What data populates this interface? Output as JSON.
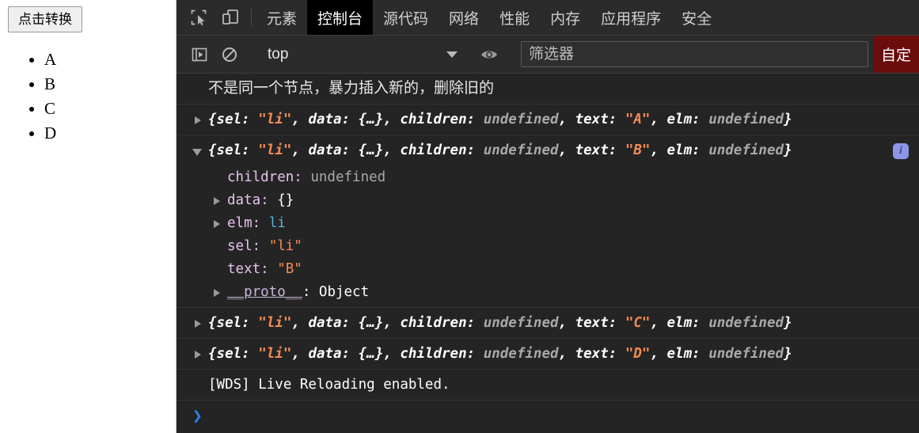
{
  "page": {
    "button_label": "点击转换",
    "list_items": [
      "A",
      "B",
      "C",
      "D"
    ]
  },
  "devtools": {
    "icons": {
      "inspect": "inspect-element-icon",
      "device": "device-toolbar-icon"
    },
    "tabs": [
      {
        "label": "元素",
        "active": false
      },
      {
        "label": "控制台",
        "active": true
      },
      {
        "label": "源代码",
        "active": false
      },
      {
        "label": "网络",
        "active": false
      },
      {
        "label": "性能",
        "active": false
      },
      {
        "label": "内存",
        "active": false
      },
      {
        "label": "应用程序",
        "active": false
      },
      {
        "label": "安全",
        "active": false
      }
    ],
    "filterbar": {
      "sidebar_toggle": "console-sidebar-icon",
      "clear_icon": "clear-console-icon",
      "context": "top",
      "eye_icon": "live-expression-eye-icon",
      "filter_placeholder": "筛选器",
      "filter_value": "",
      "level_label": "自定"
    },
    "console": {
      "messages": [
        {
          "kind": "log",
          "arrow": "none",
          "text": "不是同一个节点，暴力插入新的，删除旧的"
        },
        {
          "kind": "object",
          "arrow": "right",
          "parts": [
            {
              "t": "{sel: ",
              "c": "c-key"
            },
            {
              "t": "\"li\"",
              "c": "c-str"
            },
            {
              "t": ", data: {…}, children: ",
              "c": "c-key"
            },
            {
              "t": "undefined",
              "c": "c-undef"
            },
            {
              "t": ", text: ",
              "c": "c-key"
            },
            {
              "t": "\"A\"",
              "c": "c-str"
            },
            {
              "t": ", elm: ",
              "c": "c-key"
            },
            {
              "t": "undefined",
              "c": "c-undef"
            },
            {
              "t": "}",
              "c": "c-punct"
            }
          ]
        },
        {
          "kind": "object-expanded",
          "arrow": "down",
          "badge": "i",
          "parts": [
            {
              "t": "{sel: ",
              "c": "c-key"
            },
            {
              "t": "\"li\"",
              "c": "c-str"
            },
            {
              "t": ", data: {…}, children: ",
              "c": "c-key"
            },
            {
              "t": "undefined",
              "c": "c-undef"
            },
            {
              "t": ", text: ",
              "c": "c-key"
            },
            {
              "t": "\"B\"",
              "c": "c-str"
            },
            {
              "t": ", elm: ",
              "c": "c-key"
            },
            {
              "t": "undefined",
              "c": "c-undef"
            },
            {
              "t": "}",
              "c": "c-punct"
            }
          ],
          "props": [
            {
              "arrow": "none",
              "parts": [
                {
                  "t": "children: ",
                  "c": "c-prop"
                },
                {
                  "t": "undefined",
                  "c": "c-undef"
                }
              ]
            },
            {
              "arrow": "right",
              "parts": [
                {
                  "t": "data: ",
                  "c": "c-prop"
                },
                {
                  "t": "{}",
                  "c": "c-plain"
                }
              ]
            },
            {
              "arrow": "right",
              "parts": [
                {
                  "t": "elm: ",
                  "c": "c-prop"
                },
                {
                  "t": "li",
                  "c": "c-node"
                }
              ]
            },
            {
              "arrow": "none",
              "parts": [
                {
                  "t": "sel: ",
                  "c": "c-prop"
                },
                {
                  "t": "\"li\"",
                  "c": "c-str"
                }
              ]
            },
            {
              "arrow": "none",
              "parts": [
                {
                  "t": "text: ",
                  "c": "c-prop"
                },
                {
                  "t": "\"B\"",
                  "c": "c-str"
                }
              ]
            },
            {
              "arrow": "right",
              "proto": true,
              "parts": [
                {
                  "t": "__proto__",
                  "c": "proto-name"
                },
                {
                  "t": ": ",
                  "c": "c-plain"
                },
                {
                  "t": "Object",
                  "c": "c-plain"
                }
              ]
            }
          ]
        },
        {
          "kind": "object",
          "arrow": "right",
          "parts": [
            {
              "t": "{sel: ",
              "c": "c-key"
            },
            {
              "t": "\"li\"",
              "c": "c-str"
            },
            {
              "t": ", data: {…}, children: ",
              "c": "c-key"
            },
            {
              "t": "undefined",
              "c": "c-undef"
            },
            {
              "t": ", text: ",
              "c": "c-key"
            },
            {
              "t": "\"C\"",
              "c": "c-str"
            },
            {
              "t": ", elm: ",
              "c": "c-key"
            },
            {
              "t": "undefined",
              "c": "c-undef"
            },
            {
              "t": "}",
              "c": "c-punct"
            }
          ]
        },
        {
          "kind": "object",
          "arrow": "right",
          "parts": [
            {
              "t": "{sel: ",
              "c": "c-key"
            },
            {
              "t": "\"li\"",
              "c": "c-str"
            },
            {
              "t": ", data: {…}, children: ",
              "c": "c-key"
            },
            {
              "t": "undefined",
              "c": "c-undef"
            },
            {
              "t": ", text: ",
              "c": "c-key"
            },
            {
              "t": "\"D\"",
              "c": "c-str"
            },
            {
              "t": ", elm: ",
              "c": "c-key"
            },
            {
              "t": "undefined",
              "c": "c-undef"
            },
            {
              "t": "}",
              "c": "c-punct"
            }
          ]
        },
        {
          "kind": "mono-log",
          "arrow": "none",
          "text": "[WDS] Live Reloading enabled."
        }
      ],
      "prompt_caret": "❯"
    }
  },
  "colors": {
    "devtools_bg": "#242424",
    "toolbar_bg": "#2b2b2b",
    "active_tab_bg": "#000000",
    "string_orange": "#f28b54",
    "prop_violet": "#e6c3f0",
    "node_blue": "#5db0d7",
    "level_badge_red": "#6b0d0d",
    "info_badge_blue": "#8b96e8",
    "prompt_blue": "#2f7fe8"
  }
}
